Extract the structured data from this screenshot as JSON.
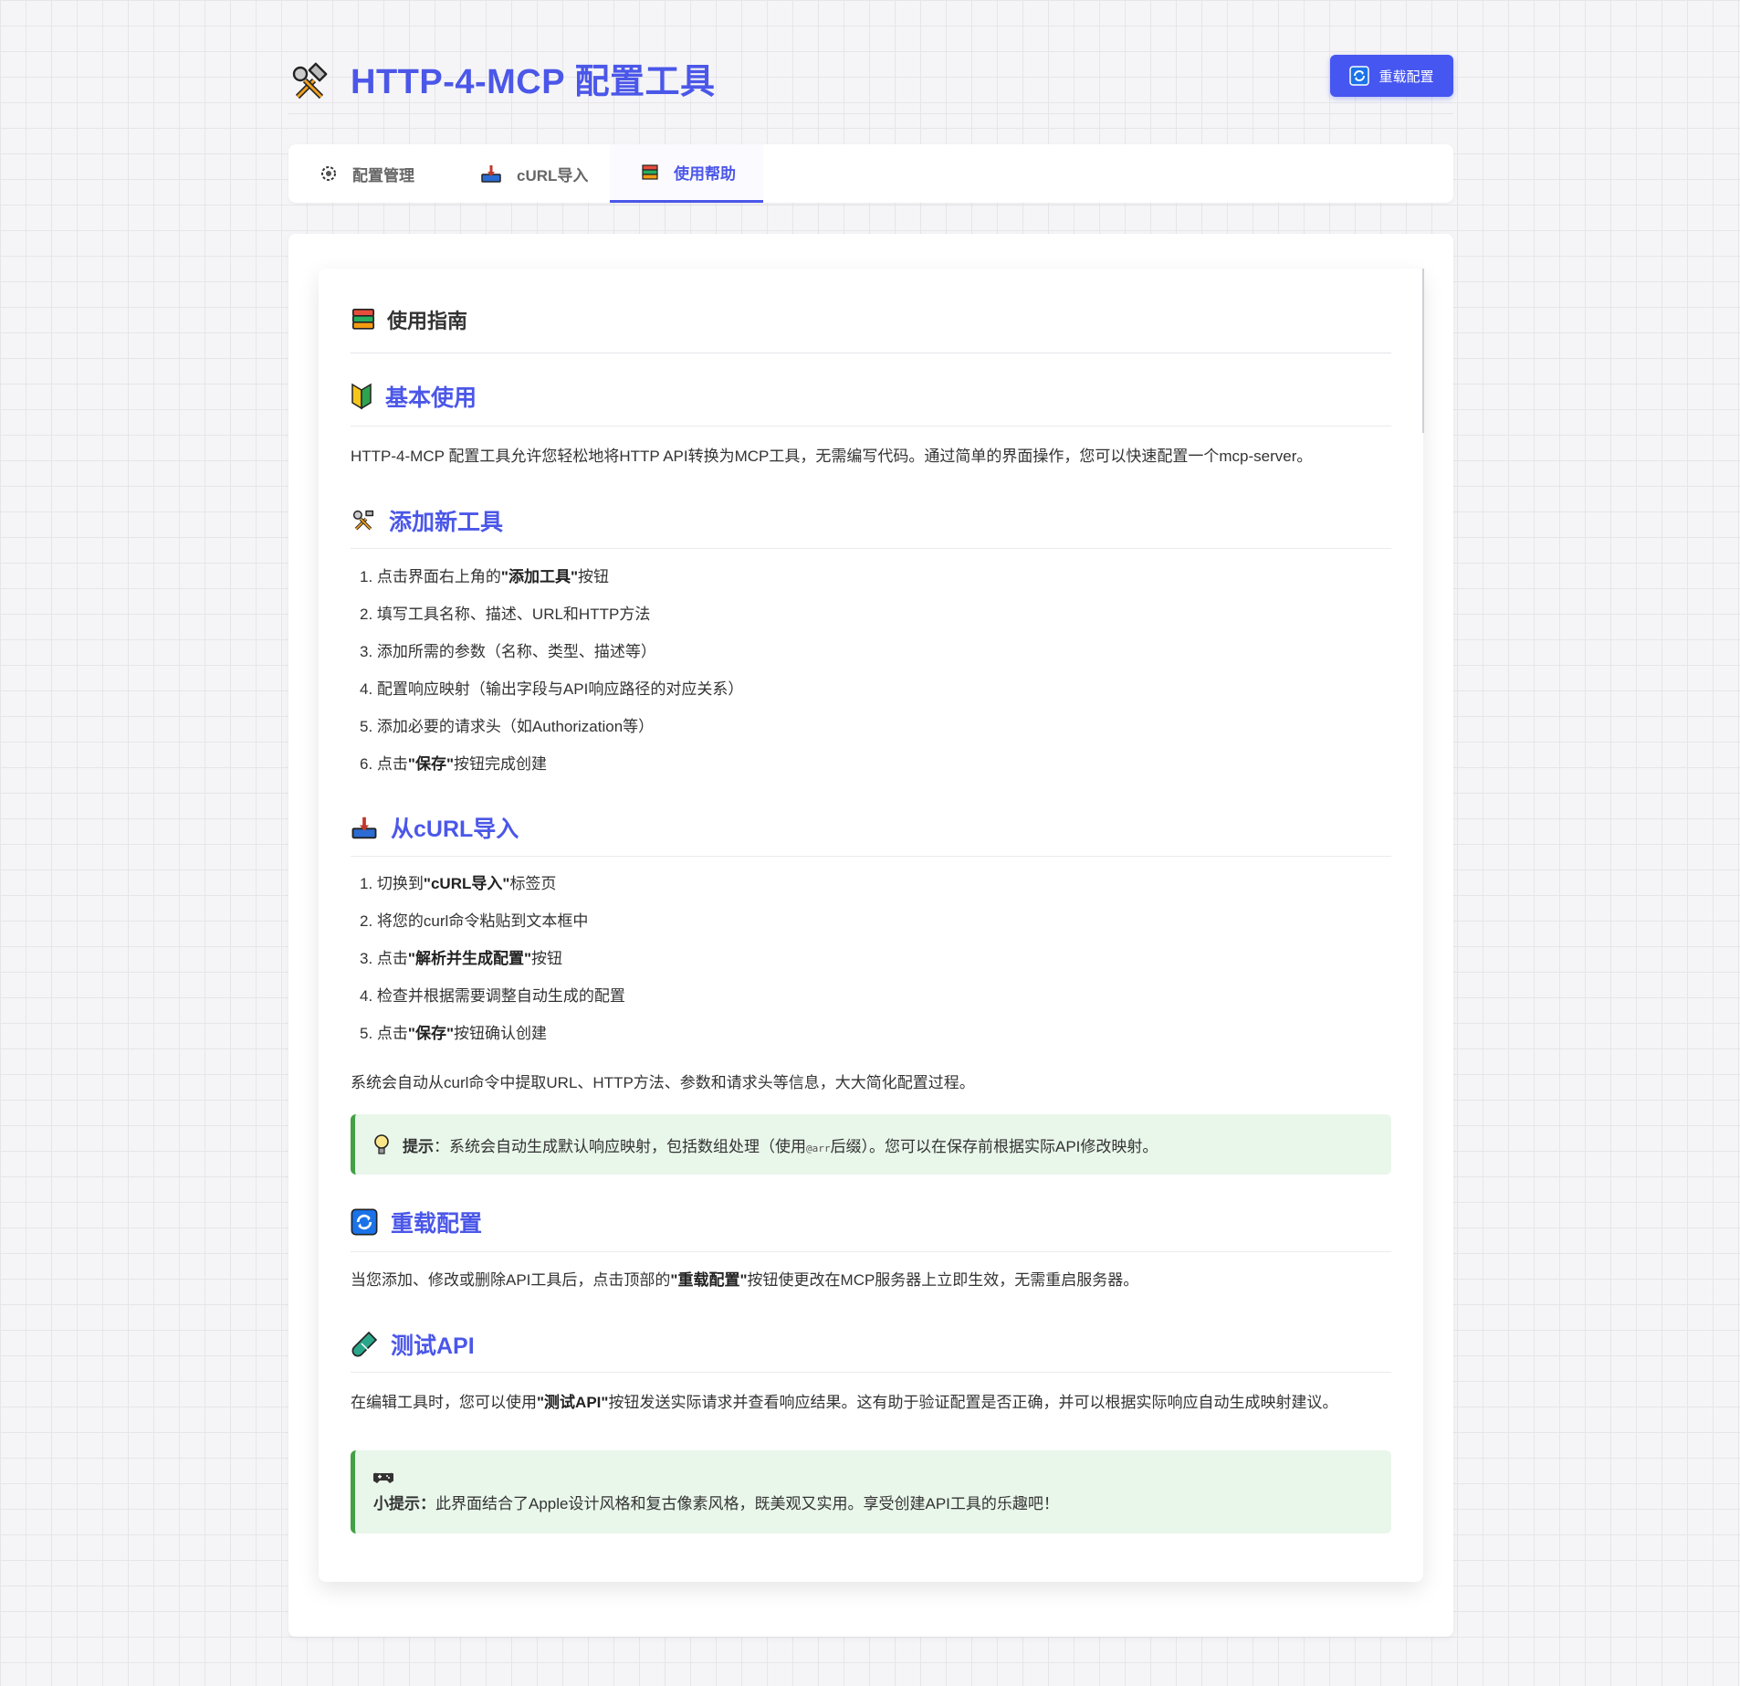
{
  "app": {
    "title": "HTTP-4-MCP 配置工具",
    "reload_button": "重载配置"
  },
  "tabs": [
    {
      "label": "配置管理",
      "icon": "gear-icon"
    },
    {
      "label": "cURL导入",
      "icon": "inbox-tray-icon"
    },
    {
      "label": "使用帮助",
      "icon": "books-icon",
      "active": true
    }
  ],
  "help": {
    "title": "使用指南",
    "basic": {
      "title": "基本使用",
      "text": "HTTP-4-MCP 配置工具允许您轻松地将HTTP API转换为MCP工具，无需编写代码。通过简单的界面操作，您可以快速配置一个mcp-server。"
    },
    "add_tool": {
      "title": "添加新工具",
      "steps": [
        {
          "n": "1.",
          "pre": "点击界面右上角的",
          "bold": "\"添加工具\"",
          "post": "按钮"
        },
        {
          "n": "2.",
          "pre": "填写工具名称、描述、URL和HTTP方法",
          "bold": "",
          "post": ""
        },
        {
          "n": "3.",
          "pre": "添加所需的参数（名称、类型、描述等）",
          "bold": "",
          "post": ""
        },
        {
          "n": "4.",
          "pre": "配置响应映射（输出字段与API响应路径的对应关系）",
          "bold": "",
          "post": ""
        },
        {
          "n": "5.",
          "pre": "添加必要的请求头（如Authorization等）",
          "bold": "",
          "post": ""
        },
        {
          "n": "6.",
          "pre": "点击",
          "bold": "\"保存\"",
          "post": "按钮完成创建"
        }
      ]
    },
    "curl": {
      "title": "从cURL导入",
      "steps": [
        {
          "n": "1.",
          "pre": "切换到",
          "bold": "\"cURL导入\"",
          "post": "标签页"
        },
        {
          "n": "2.",
          "pre": "将您的curl命令粘贴到文本框中",
          "bold": "",
          "post": ""
        },
        {
          "n": "3.",
          "pre": "点击",
          "bold": "\"解析并生成配置\"",
          "post": "按钮"
        },
        {
          "n": "4.",
          "pre": "检查并根据需要调整自动生成的配置",
          "bold": "",
          "post": ""
        },
        {
          "n": "5.",
          "pre": "点击",
          "bold": "\"保存\"",
          "post": "按钮确认创建"
        }
      ],
      "note": "系统会自动从curl命令中提取URL、HTTP方法、参数和请求头等信息，大大简化配置过程。",
      "tip": {
        "label": "提示",
        "pre": "：系统会自动生成默认响应映射，包括数组处理（使用",
        "code": "@arr",
        "post": "后缀）。您可以在保存前根据实际API修改映射。"
      }
    },
    "reload": {
      "title": "重载配置",
      "pre": "当您添加、修改或删除API工具后，点击顶部的",
      "bold": "\"重载配置\"",
      "post": "按钮使更改在MCP服务器上立即生效，无需重启服务器。"
    },
    "test": {
      "title": "测试API",
      "pre": "在编辑工具时，您可以使用",
      "bold": "\"测试API\"",
      "post": "按钮发送实际请求并查看响应结果。这有助于验证配置是否正确，并可以根据实际响应自动生成映射建议。"
    },
    "final_tip": {
      "label": "小提示：",
      "text": "此界面结合了Apple设计风格和复古像素风格，既美观又实用。享受创建API工具的乐趣吧！"
    }
  },
  "colors": {
    "accent": "#4b57e8",
    "button": "#4656f0",
    "tip_bg": "#e9f6ea",
    "tip_border": "#43a047"
  }
}
